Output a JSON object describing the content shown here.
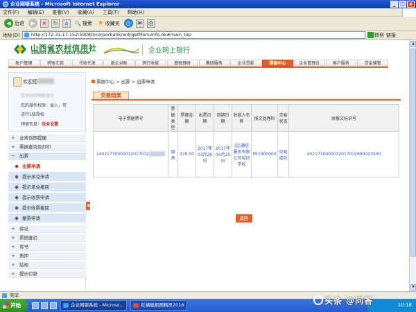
{
  "window": {
    "title": "企业网银系统 - Microsoft Internet Explorer",
    "controls": [
      "_",
      "□",
      "×"
    ]
  },
  "menubar": [
    "文件(F)",
    "编辑(E)",
    "查看(V)",
    "收藏(A)",
    "工具(T)",
    "帮助(H)"
  ],
  "toolbar": {
    "back": "后退",
    "search": "搜索",
    "favorites": "收藏夹"
  },
  "address": {
    "label": "地址(D)",
    "url": "http://172.31.17.152:59080/corporbank/ent/getMenuInfo.do#main_top",
    "go": "转到",
    "links": "链接"
  },
  "bank": {
    "name": "山西省农村信用社",
    "name_en": "SHANXI RURAL CREDIT UNION",
    "subtitle": "企业网上银行"
  },
  "nav": [
    {
      "label": "账户管理",
      "active": false
    },
    {
      "label": "转账汇款",
      "active": false
    },
    {
      "label": "代收代发",
      "active": false
    },
    {
      "label": "银企对账",
      "active": false
    },
    {
      "label": "跨行收款",
      "active": false
    },
    {
      "label": "基础理财",
      "active": false
    },
    {
      "label": "集团服务",
      "active": false
    },
    {
      "label": "企业贷款",
      "active": false
    },
    {
      "label": "票据中心",
      "active": true
    },
    {
      "label": "企业管理台",
      "active": false
    },
    {
      "label": "客户服务",
      "active": false
    },
    {
      "label": "贷金辅管",
      "active": false
    }
  ],
  "sidebar": {
    "welcome": "欢迎您",
    "line1": "您有待待授权指令",
    "line2": "您的操作权限：录入，可",
    "line3": "进行1级授权",
    "line4_label": "预留信息：",
    "line4_value": "尚未设置",
    "groups_top": [
      "业务到期提醒",
      "票据查询及打印",
      "出票"
    ],
    "items": [
      {
        "label": "出票申请",
        "active": true
      },
      {
        "label": "提示承兑申请",
        "active": false
      },
      {
        "label": "提示承兑撤回",
        "active": false
      },
      {
        "label": "提示收票申请",
        "active": false
      },
      {
        "label": "提示收票撤回",
        "active": false
      },
      {
        "label": "撤票申请",
        "active": false
      }
    ],
    "groups_bottom": [
      "保证",
      "票据查验",
      "背书",
      "质押",
      "贴现",
      "提示付款"
    ],
    "collapse": "◀"
  },
  "main": {
    "breadcrumb": "票据中心 > 出票 > 出票申请",
    "result_tab": "交易结果",
    "table": {
      "headers": [
        "电子票据票号",
        "票据类型",
        "票面金额",
        "出票日期",
        "到期日期",
        "收款人名称",
        "报文处理码",
        "交易状态",
        "原报文标识号"
      ],
      "row": {
        "bill_no_prefix": "14021770000032017032",
        "bill_type": "银承",
        "amount": "329.00",
        "issue_date": "2017年03月26日",
        "due_date": "2017年04月25日",
        "payee": "通信服务有限公司培训学校",
        "proc_code": "PE1000000",
        "status": "交易成功",
        "orig_id": "4021770000032017032699323500"
      }
    },
    "confirm": "返回"
  },
  "statusbar": "完毕",
  "taskbar": {
    "start": "开始",
    "tasks": [
      {
        "label": "企业网银系统 - Microso...",
        "active": true
      },
      {
        "label": "红蜻蜓抓图精灵2016",
        "active": false
      }
    ],
    "clock": "10:18",
    "watermark": "头条 @问答"
  }
}
